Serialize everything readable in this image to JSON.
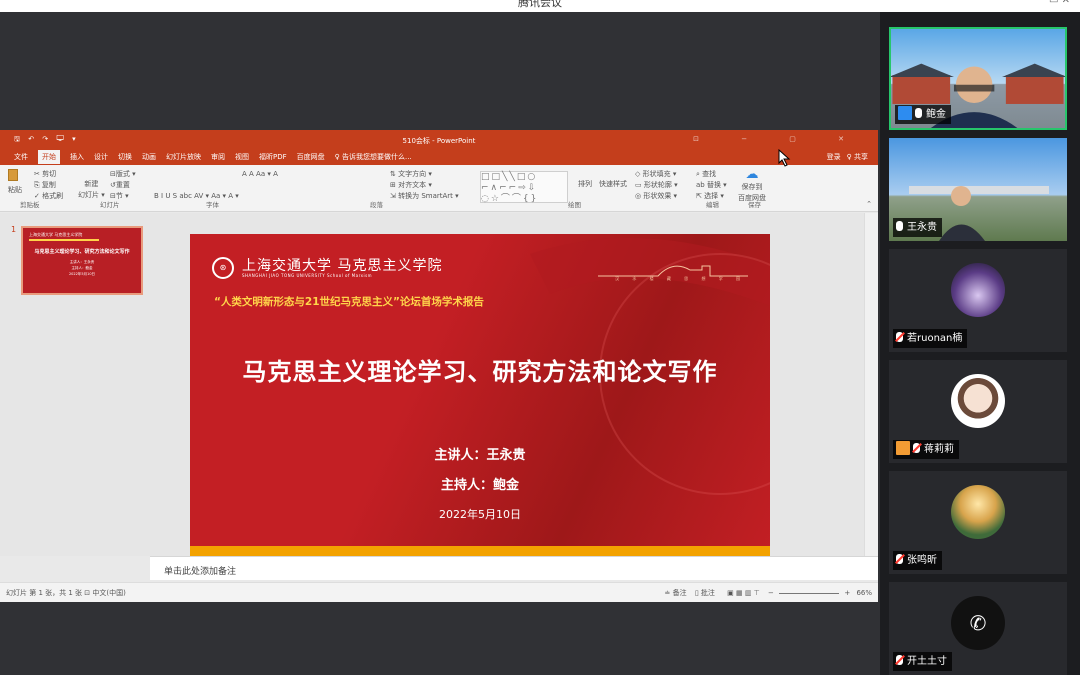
{
  "window": {
    "title": "腾讯会议",
    "controls": "▭  ✕"
  },
  "ppt": {
    "quick_access": "🖫 ↶ ↷ 🖵 ▾",
    "doc_title": "510会标 - PowerPoint",
    "window_controls": "⊡ − ▢ ✕",
    "menu": [
      "文件",
      "开始",
      "插入",
      "设计",
      "切换",
      "动画",
      "幻灯片放映",
      "审阅",
      "视图",
      "福昕PDF",
      "百度网盘",
      "♀ 告诉我您想要做什么..."
    ],
    "active_menu_index": 1,
    "login": "登录",
    "share": "♀ 共享",
    "ribbon": {
      "clipboard": {
        "paste": "粘贴",
        "cut": "✂ 剪切",
        "copy": "⎘ 复制",
        "format": "✓ 格式刷",
        "label": "剪贴板"
      },
      "slides": {
        "new": "新建",
        "new2": "幻灯片 ▾",
        "layout": "⊟版式 ▾",
        "reset": "↺重置",
        "section": "⊟节 ▾",
        "label": "幻灯片"
      },
      "font": {
        "row1": "A A  Aa ▾  A",
        "row2": "B  I  U  S  abc  AV ▾  Aa ▾  A ▾",
        "label": "字体"
      },
      "paragraph": {
        "dir": "⇅ 文字方向 ▾",
        "align": "⊞ 对齐文本 ▾",
        "smartart": "⇲ 转换为 SmartArt ▾",
        "label": "段落"
      },
      "drawing": {
        "arrange": "排列",
        "quick": "快速样式",
        "fill": "◇ 形状填充 ▾",
        "outline": "▭ 形状轮廓 ▾",
        "effect": "◎ 形状效果 ▾",
        "label": "绘图"
      },
      "editing": {
        "find": "⌕ 查找",
        "replace": "ab 替换 ▾",
        "select": "⇱ 选择 ▾",
        "label": "编辑"
      },
      "save": {
        "line1": "保存到",
        "line2": "百度网盘",
        "label": "保存"
      }
    },
    "thumbnail": {
      "number": "1",
      "header": "上海交通大学 马克思主义学院",
      "title": "马克思主义理论学习、研究方法和论文写作",
      "sub1": "主讲人：王永贵",
      "sub2": "主持人：鲍金",
      "sub3": "2022年5月10日"
    },
    "slide": {
      "seal": "⊛",
      "brand": "上海交通大学  马克思主义学院",
      "brand_sub": "SHANGHAI JIAO TONG UNIVERSITY        School of Marxism",
      "sky_text": "汉 水 楼 藏   思 想 学 园",
      "forum": "“人类文明新形态与21世纪马克思主义”论坛首场学术报告",
      "main_title": "马克思主义理论学习、研究方法和论文写作",
      "speaker": "主讲人：王永贵",
      "host": "主持人：鲍金",
      "date": "2022年5月10日"
    },
    "notes_placeholder": "单击此处添加备注",
    "status": {
      "left": "幻灯片 第 1 张，共 1 张   ⊡   中文(中国)",
      "notes": "≐ 备注",
      "comments": "▯ 批注",
      "zoom": "66%"
    }
  },
  "participants": [
    {
      "name": "鲍金",
      "muted": false,
      "video": true,
      "badge": "blue",
      "active": true
    },
    {
      "name": "王永贵",
      "muted": false,
      "video": true,
      "badge": "none",
      "active": false
    },
    {
      "name": "若ruonan楠",
      "muted": true,
      "video": false,
      "badge": "none",
      "active": false
    },
    {
      "name": "蒋莉莉",
      "muted": true,
      "video": false,
      "badge": "orange",
      "active": false
    },
    {
      "name": "张鸣昕",
      "muted": true,
      "video": false,
      "badge": "none",
      "active": false
    },
    {
      "name": "开土土寸",
      "muted": true,
      "video": false,
      "badge": "none",
      "active": false
    }
  ]
}
